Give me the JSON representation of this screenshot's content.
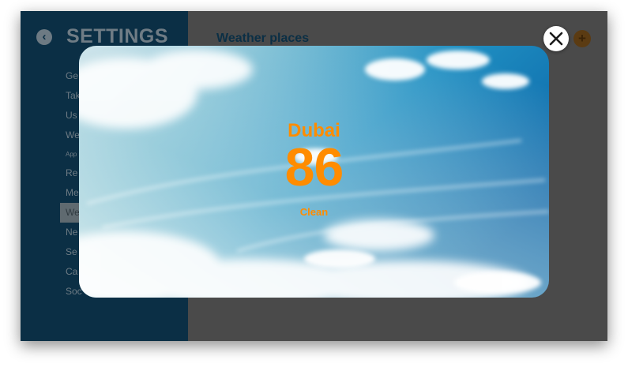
{
  "settings": {
    "title": "SETTINGS",
    "nav_items": [
      {
        "label": "Ge"
      },
      {
        "label": "Tak"
      },
      {
        "label": "Us"
      },
      {
        "label": "We"
      },
      {
        "label": "App"
      },
      {
        "label": "Re"
      },
      {
        "label": "Me"
      },
      {
        "label": "We"
      },
      {
        "label": "Ne"
      },
      {
        "label": "Se"
      },
      {
        "label": "Ca"
      },
      {
        "label": "Soc"
      }
    ],
    "active_index": 7
  },
  "page": {
    "heading": "Weather places"
  },
  "modal": {
    "city": "Dubai",
    "temperature": "86",
    "condition": "Clean"
  },
  "icons": {
    "back": "back-arrow-icon",
    "add": "plus-icon",
    "close": "close-icon"
  },
  "colors": {
    "sidebar": "#0b2f45",
    "accent": "#ff8c00",
    "overlay": "#4a4a4a"
  }
}
